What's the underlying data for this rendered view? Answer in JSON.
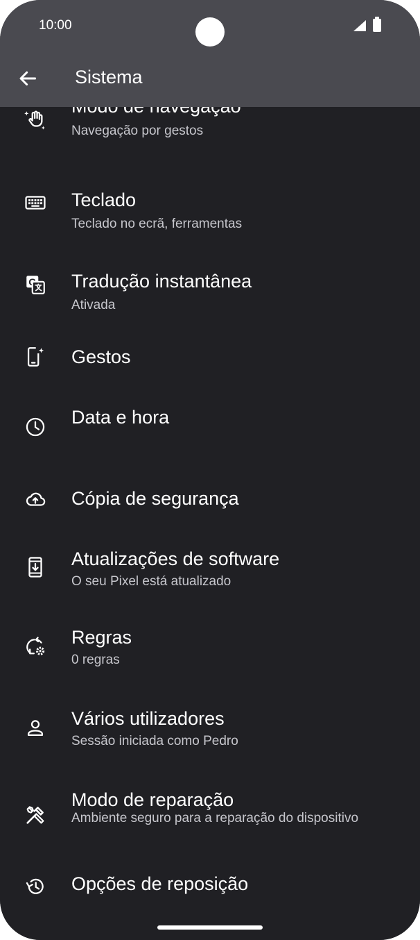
{
  "status_bar": {
    "time": "10:00",
    "signal_icon": "signal-icon",
    "battery_icon": "battery-icon"
  },
  "app_bar": {
    "back_icon": "back-arrow-icon",
    "title": "Sistema"
  },
  "items": [
    {
      "label": "Modo de navegação",
      "sub": "Navegação por gestos",
      "icon": "navigation-gesture-icon"
    },
    {
      "label": "Teclado",
      "sub": "Teclado no ecrã, ferramentas",
      "icon": "keyboard-icon"
    },
    {
      "label": "Tradução instantânea",
      "sub": "Ativada",
      "icon": "translate-icon"
    },
    {
      "label": "Gestos",
      "sub": "",
      "icon": "gestures-phone-icon"
    },
    {
      "label": "Data e hora",
      "sub": "",
      "icon": "clock-icon"
    },
    {
      "label": "Cópia de segurança",
      "sub": "",
      "icon": "cloud-upload-icon"
    },
    {
      "label": "Atualizações de software",
      "sub": "O seu Pixel está atualizado",
      "icon": "system-update-icon"
    },
    {
      "label": "Regras",
      "sub": "0 regras",
      "icon": "rules-icon"
    },
    {
      "label": "Vários utilizadores",
      "sub": "Sessão iniciada como Pedro",
      "icon": "person-icon"
    },
    {
      "label": "Modo de reparação",
      "sub": "Ambiente seguro para a reparação do dispositivo",
      "icon": "repair-tools-icon"
    }
  ],
  "reset": {
    "label": "Opções de reposição",
    "icon": "history-icon"
  }
}
